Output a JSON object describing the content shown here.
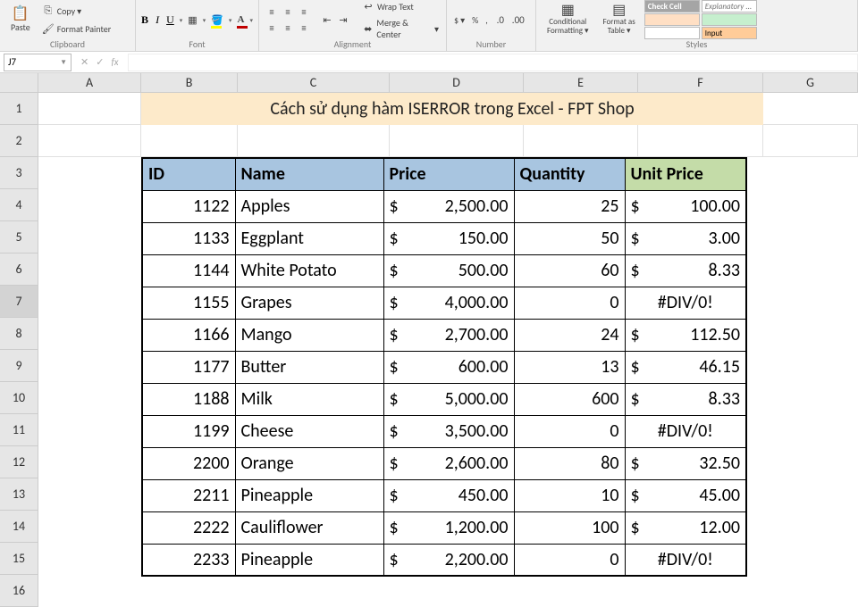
{
  "ribbon": {
    "clipboard": {
      "label": "Clipboard",
      "paste": "Paste",
      "copy": "Copy",
      "format_painter": "Format Painter"
    },
    "font": {
      "label": "Font",
      "bold": "B",
      "italic": "I",
      "underline": "U"
    },
    "alignment": {
      "label": "Alignment",
      "wrap": "Wrap Text",
      "merge": "Merge & Center"
    },
    "number": {
      "label": "Number",
      "currency": "$"
    },
    "styles": {
      "label": "Styles",
      "cond": "Conditional Formatting",
      "fmt_table": "Format as Table",
      "check_cell": "Check Cell",
      "explanatory": "Explanatory ...",
      "input": "Input"
    }
  },
  "formula_bar": {
    "cell_ref": "J7",
    "fx": "fx"
  },
  "cols": [
    "A",
    "B",
    "C",
    "D",
    "E",
    "F",
    "G"
  ],
  "rows": [
    "1",
    "2",
    "3",
    "4",
    "5",
    "6",
    "7",
    "8",
    "9",
    "10",
    "11",
    "12",
    "13",
    "14",
    "15",
    "16"
  ],
  "selected_row": "7",
  "data": {
    "title": "Cách sử dụng hàm ISERROR trong Excel - FPT Shop",
    "headers": {
      "id": "ID",
      "name": "Name",
      "price": "Price",
      "quantity": "Quantity",
      "unit": "Unit Price"
    },
    "rows": [
      {
        "id": "1122",
        "name": "Apples",
        "price": "2,500.00",
        "qty": "25",
        "unit": "100.00"
      },
      {
        "id": "1133",
        "name": "Eggplant",
        "price": "150.00",
        "qty": "50",
        "unit": "3.00"
      },
      {
        "id": "1144",
        "name": "White Potato",
        "price": "500.00",
        "qty": "60",
        "unit": "8.33"
      },
      {
        "id": "1155",
        "name": "Grapes",
        "price": "4,000.00",
        "qty": "0",
        "unit_err": "#DIV/0!"
      },
      {
        "id": "1166",
        "name": "Mango",
        "price": "2,700.00",
        "qty": "24",
        "unit": "112.50"
      },
      {
        "id": "1177",
        "name": "Butter",
        "price": "600.00",
        "qty": "13",
        "unit": "46.15"
      },
      {
        "id": "1188",
        "name": "Milk",
        "price": "5,000.00",
        "qty": "600",
        "unit": "8.33"
      },
      {
        "id": "1199",
        "name": "Cheese",
        "price": "3,500.00",
        "qty": "0",
        "unit_err": "#DIV/0!"
      },
      {
        "id": "2200",
        "name": "Orange",
        "price": "2,600.00",
        "qty": "80",
        "unit": "32.50"
      },
      {
        "id": "2211",
        "name": "Pineapple",
        "price": "450.00",
        "qty": "10",
        "unit": "45.00"
      },
      {
        "id": "2222",
        "name": "Cauliflower",
        "price": "1,200.00",
        "qty": "100",
        "unit": "12.00"
      },
      {
        "id": "2233",
        "name": "Pineapple",
        "price": "2,200.00",
        "qty": "0",
        "unit_err": "#DIV/0!"
      }
    ]
  }
}
